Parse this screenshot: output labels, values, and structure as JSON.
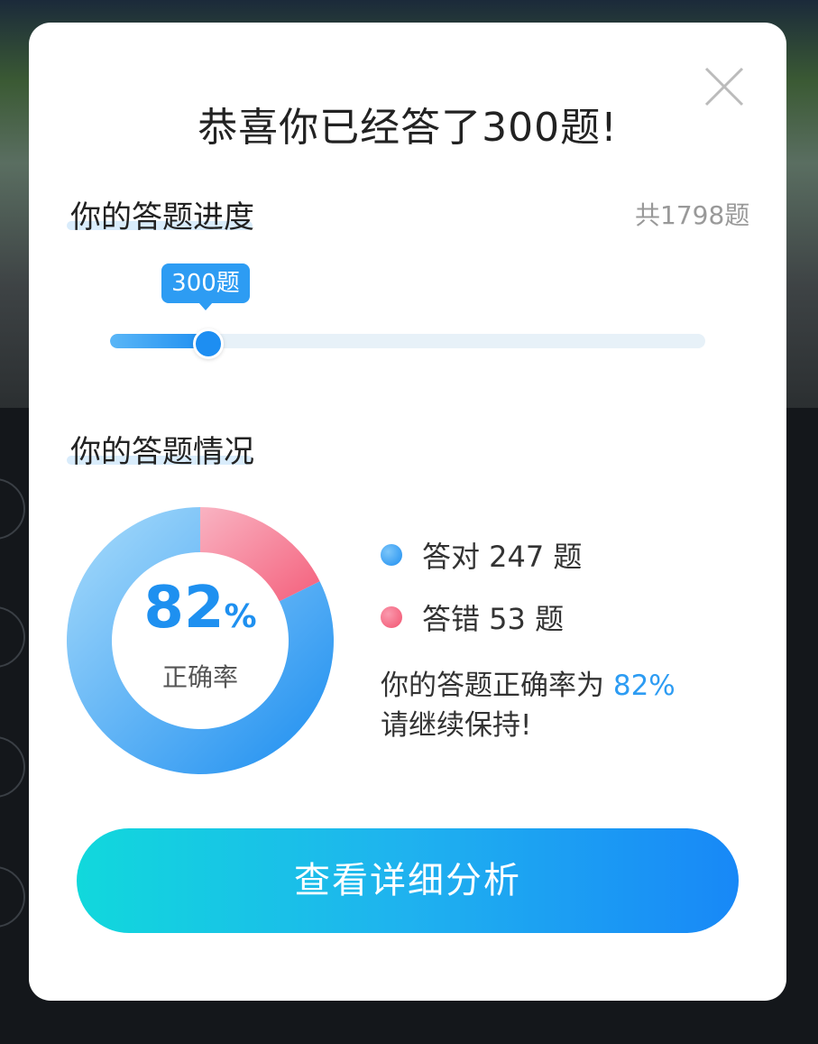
{
  "modal": {
    "title": "恭喜你已经答了300题!",
    "close_icon": "close-icon"
  },
  "progress": {
    "heading": "你的答题进度",
    "total": "共1798题",
    "answered_label": "300题",
    "answered": 300,
    "total_count": 1798,
    "fraction": 0.167
  },
  "stats": {
    "heading": "你的答题情况",
    "accuracy_value": "82",
    "accuracy_unit": "%",
    "accuracy_label": "正确率",
    "correct_label": "答对 247 题",
    "wrong_label": "答错 53 题",
    "correct_count": 247,
    "wrong_count": 53,
    "summary_line1_prefix": "你的答题正确率为 ",
    "summary_line1_value": "82%",
    "summary_line2": "请继续保持!"
  },
  "actions": {
    "detail_button": "查看详细分析"
  },
  "colors": {
    "accent_blue": "#1e90f0",
    "correct_dot": "#2d9cf3",
    "wrong_dot": "#f4607c",
    "button_gradient_start": "#11d8dc",
    "button_gradient_end": "#1888f7"
  }
}
